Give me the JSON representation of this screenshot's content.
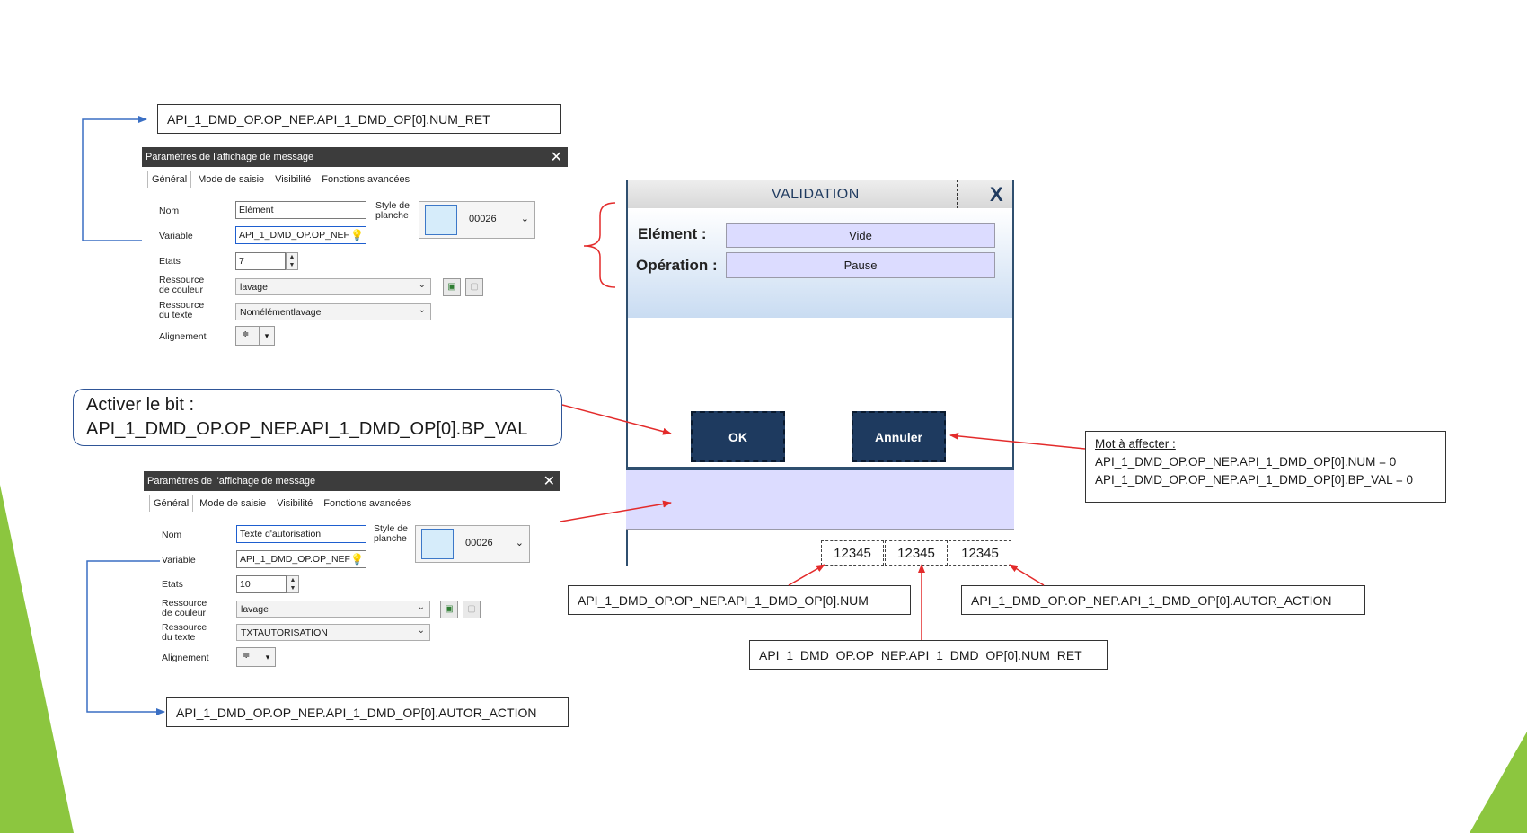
{
  "callouts": {
    "top_num_ret": "API_1_DMD_OP.OP_NEP.API_1_DMD_OP[0].NUM_RET",
    "bottom_autor_action": "API_1_DMD_OP.OP_NEP.API_1_DMD_OP[0].AUTOR_ACTION",
    "num": "API_1_DMD_OP.OP_NEP.API_1_DMD_OP[0].NUM",
    "autor_action_right": "API_1_DMD_OP.OP_NEP.API_1_DMD_OP[0].AUTOR_ACTION",
    "num_ret_center": "API_1_DMD_OP.OP_NEP.API_1_DMD_OP[0].NUM_RET"
  },
  "bubble": {
    "line1": "Activer le bit :",
    "line2": "API_1_DMD_OP.OP_NEP.API_1_DMD_OP[0].BP_VAL"
  },
  "note": {
    "title": "Mot à affecter :",
    "line1": "API_1_DMD_OP.OP_NEP.API_1_DMD_OP[0].NUM = 0",
    "line2": "API_1_DMD_OP.OP_NEP.API_1_DMD_OP[0].BP_VAL = 0"
  },
  "dialog_top": {
    "title": "Paramètres de l'affichage de message",
    "close": "✕",
    "tabs": [
      "Général",
      "Mode de saisie",
      "Visibilité",
      "Fonctions avancées"
    ],
    "labels": {
      "nom": "Nom",
      "variable": "Variable",
      "etats": "Etats",
      "res_couleur_1": "Ressource",
      "res_couleur_2": "de couleur",
      "res_texte_1": "Ressource",
      "res_texte_2": "du texte",
      "alignement": "Alignement",
      "style_1": "Style de",
      "style_2": "planche"
    },
    "nom_value": "Elément",
    "variable_value": "API_1_DMD_OP.OP_NEF",
    "etats_value": "7",
    "couleur_value": "lavage",
    "texte_value": "Nomélémentlavage",
    "style_value": "00026"
  },
  "dialog_bottom": {
    "title": "Paramètres de l'affichage de message",
    "close": "✕",
    "tabs": [
      "Général",
      "Mode de saisie",
      "Visibilité",
      "Fonctions avancées"
    ],
    "labels": {
      "nom": "Nom",
      "variable": "Variable",
      "etats": "Etats",
      "res_couleur_1": "Ressource",
      "res_couleur_2": "de couleur",
      "res_texte_1": "Ressource",
      "res_texte_2": "du texte",
      "alignement": "Alignement",
      "style_1": "Style de",
      "style_2": "planche"
    },
    "nom_value": "Texte d'autorisation",
    "variable_value": "API_1_DMD_OP.OP_NEF",
    "etats_value": "10",
    "couleur_value": "lavage",
    "texte_value": "TXTAUTORISATION",
    "style_value": "00026"
  },
  "hmi": {
    "title": "VALIDATION",
    "close": "X",
    "element_label": "Elément   :",
    "operation_label": "Opération :",
    "element_value": "Vide",
    "operation_value": "Pause",
    "ok": "OK",
    "cancel": "Annuler",
    "numbers": [
      "12345",
      "12345",
      "12345"
    ]
  },
  "colors": {
    "accent_green": "#8cc63f",
    "arrow_red": "#e32b2b",
    "connector_blue": "#3a6fc4",
    "hmi_button": "#1e3a5f",
    "hmi_field": "#dcdcff"
  }
}
